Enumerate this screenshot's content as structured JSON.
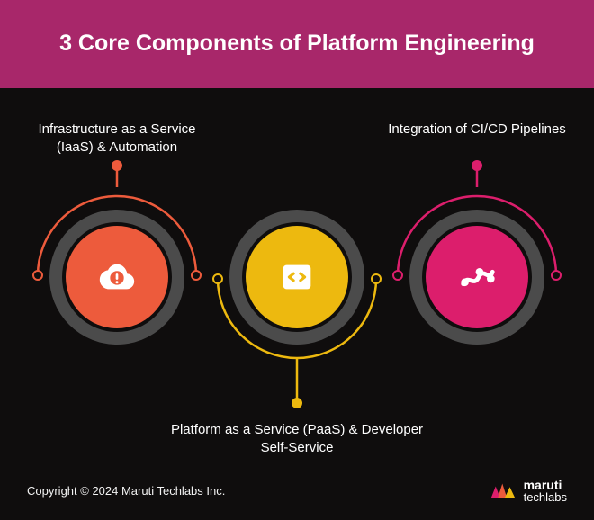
{
  "header": {
    "title": "3 Core Components of Platform Engineering",
    "bg": "#a8276a"
  },
  "nodes": {
    "iaas": {
      "label": "Infrastructure as a Service (IaaS) & Automation",
      "color": "#ed5b3c",
      "ring": "#4b4b4b"
    },
    "paas": {
      "label": "Platform as a Service (PaaS) & Developer Self-Service",
      "color": "#edb90f",
      "ring": "#4b4b4b"
    },
    "cicd": {
      "label": "Integration of CI/CD Pipelines",
      "color": "#dc1e6c",
      "ring": "#4b4b4b"
    }
  },
  "footer": {
    "copyright": "Copyright © 2024 Maruti Techlabs Inc.",
    "brand_line1": "maruti",
    "brand_line2": "techlabs"
  }
}
